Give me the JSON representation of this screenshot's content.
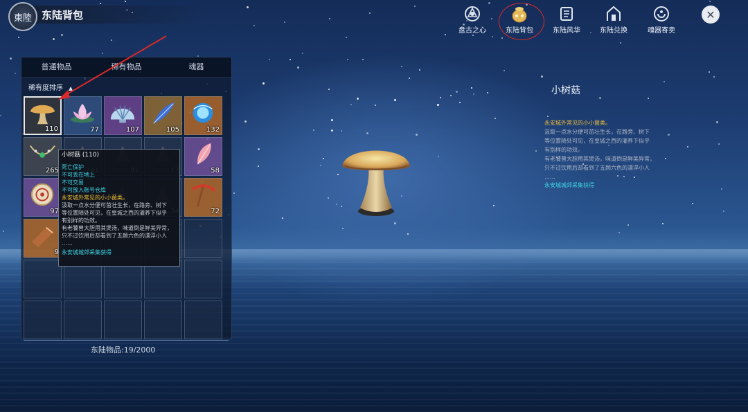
{
  "header": {
    "logo_text": "東陸",
    "title": "东陆背包"
  },
  "nav": [
    {
      "label": "盘古之心",
      "icon": "pangu-heart-icon"
    },
    {
      "label": "东陆背包",
      "icon": "bag-icon",
      "highlighted": true
    },
    {
      "label": "东陆风华",
      "icon": "scroll-icon"
    },
    {
      "label": "东陆兑换",
      "icon": "gate-exchange-icon"
    },
    {
      "label": "魂器寄卖",
      "icon": "soul-consign-icon"
    }
  ],
  "close_glyph": "✕",
  "bag": {
    "tabs": [
      "普通物品",
      "稀有物品",
      "魂器"
    ],
    "sort_label": "稀有度排序",
    "sort_arrow": "▲",
    "items": [
      {
        "count": "110",
        "icon": "mushroom-icon",
        "selected": true
      },
      {
        "count": "77",
        "icon": "lotus-icon"
      },
      {
        "count": "107",
        "icon": "seashell-icon"
      },
      {
        "count": "105",
        "icon": "blue-feather-icon"
      },
      {
        "count": "132",
        "icon": "blue-orb-icon"
      },
      {
        "count": "265",
        "icon": "necklace-icon"
      },
      {
        "count": "241",
        "icon": "item-icon"
      },
      {
        "count": "92",
        "icon": "item-icon"
      },
      {
        "count": "17",
        "icon": "item-icon"
      },
      {
        "count": "58",
        "icon": "pink-feather-icon"
      },
      {
        "count": "97",
        "icon": "compass-icon"
      },
      {
        "count": "",
        "icon": "item-icon"
      },
      {
        "count": "",
        "icon": "item-icon"
      },
      {
        "count": "34",
        "icon": "item-icon"
      },
      {
        "count": "72",
        "icon": "red-pickaxe-icon"
      },
      {
        "count": "9",
        "icon": "gauntlet-icon"
      }
    ],
    "empty_slots": 14,
    "footer": "东陆物品:19/2000"
  },
  "tooltip": {
    "title": "小树菇 (110)",
    "flags": [
      "死亡保护",
      "不可丢在地上",
      "不可交易",
      "不可放入账号仓库"
    ],
    "origin": "永安城外常见的小小菌类。",
    "desc": [
      "汲取一点水分便可茁壮生长，在路旁、树下",
      "等位置随处可见，在皇城之西的灌养下似乎",
      "有别样的功效。",
      "有老饕曾大胆用其煲汤，味道倒是鲜美异常，",
      "只不过饮用后却看到了五颜六色的漂浮小人",
      "……"
    ],
    "source": "永安城城郊采集获得"
  },
  "detail": {
    "name": "小树菇",
    "origin": "永安城外常见的小小菌类。",
    "desc": [
      "汲取一点水分便可茁壮生长，在路旁、树下",
      "等位置随处可见，在皇城之西的灌养下似乎",
      "有别样的功效。",
      "有老饕曾大胆用其煲汤，味道倒是鲜美异常，",
      "只不过饮用后却看到了五颜六色的漂浮小人",
      "……"
    ],
    "source": "永安城城郊采集获得",
    "image_icon": "mushroom-icon"
  },
  "colors": {
    "highlight_circle": "#d82a2a",
    "tooltip_flag": "#3fd6e6",
    "tooltip_origin": "#f0c03a"
  }
}
